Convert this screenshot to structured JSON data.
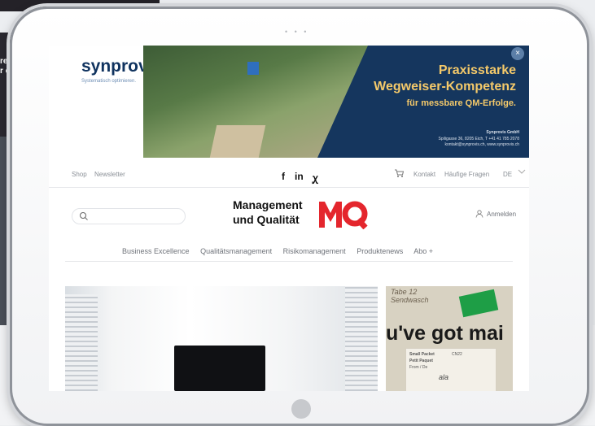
{
  "background": {
    "left_text_line1": "re",
    "left_text_line2": "r c"
  },
  "ad": {
    "logo": "synprovis",
    "tagline": "Systematisch optimieren.",
    "headline1": "Praxisstarke",
    "headline2": "Wegweiser-Kompetenz",
    "headline3": "für messbare QM-Erfolge.",
    "company": "Synprovis GmbH",
    "address": "Spiligasse 36, 8205 Eich, T +41 41 785 2078",
    "contact": "kontakt@synprovis.ch, www.synprovis.ch",
    "close_glyph": "×",
    "colors": {
      "navy": "#15365e",
      "gold": "#f4c96a"
    }
  },
  "utility": {
    "shop": "Shop",
    "newsletter": "Newsletter",
    "facebook": "f",
    "linkedin": "in",
    "xing": "ꭕ",
    "kontakt": "Kontakt",
    "faq": "Häufige Fragen",
    "language": "DE"
  },
  "header": {
    "title_line1": "Management",
    "title_line2": "und Qualität",
    "logo_letters": "MQ",
    "login": "Anmelden",
    "search_placeholder": ""
  },
  "nav": {
    "items": [
      {
        "label": "Business Excellence"
      },
      {
        "label": "Qualitätsmanagement"
      },
      {
        "label": "Risikomanagement"
      },
      {
        "label": "Produktenews"
      },
      {
        "label": "Abo +"
      }
    ]
  },
  "articles": {
    "photo2_handwriting1": "Tabe 12",
    "photo2_handwriting2": "Sendwasch",
    "photo2_headline": "u've got mai",
    "label_line1": "Small Packet",
    "label_line2": "Petit Paquet",
    "label_line3": "From / De",
    "label_code": "CN22",
    "label_script": "ala"
  }
}
